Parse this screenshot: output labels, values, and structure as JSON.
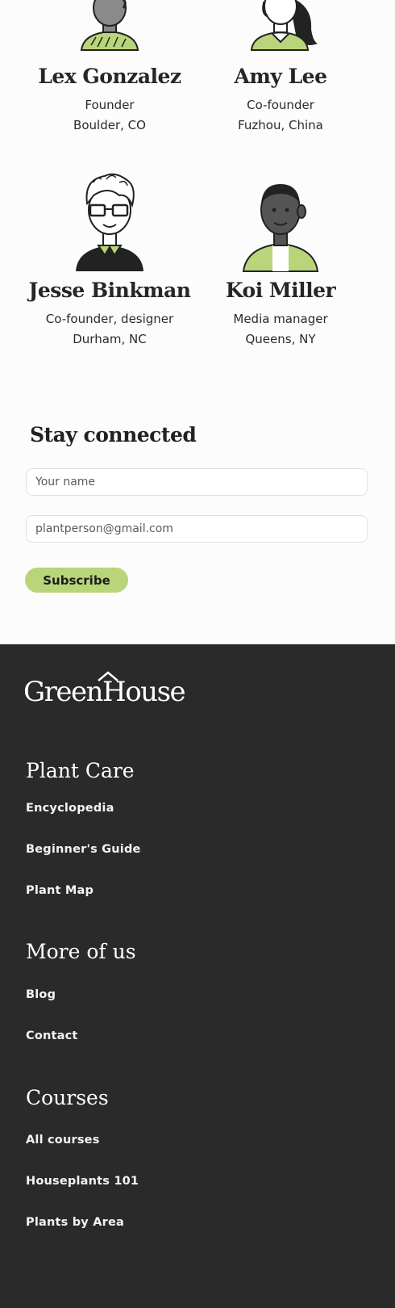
{
  "team": {
    "members": [
      {
        "name": "Lex Gonzalez",
        "role": "Founder",
        "location": "Boulder, CO",
        "avatar": "person-gray-skin-icon"
      },
      {
        "name": "Amy Lee",
        "role": "Co-founder",
        "location": "Fuzhou, China",
        "avatar": "person-long-hair-icon"
      },
      {
        "name": "Jesse Binkman",
        "role": "Co-founder, designer",
        "location": "Durham, NC",
        "avatar": "person-glasses-icon"
      },
      {
        "name": "Koi Miller",
        "role": "Media manager",
        "location": "Queens, NY",
        "avatar": "person-dark-skin-icon"
      }
    ]
  },
  "newsletter": {
    "title": "Stay connected",
    "name_placeholder": "Your name",
    "email_placeholder": "plantperson@gmail.com",
    "subscribe_label": "Subscribe"
  },
  "footer": {
    "logo": "GreenHouse",
    "sections": [
      {
        "title": "Plant Care",
        "links": [
          "Encyclopedia",
          "Beginner's Guide",
          "Plant Map"
        ]
      },
      {
        "title": "More of us",
        "links": [
          "Blog",
          "Contact"
        ]
      },
      {
        "title": "Courses",
        "links": [
          "All courses",
          "Houseplants 101",
          "Plants by Area"
        ]
      }
    ]
  },
  "colors": {
    "accent": "#b9d57a",
    "footer_bg": "#2a2a2a",
    "page_bg": "#fcfcfc"
  }
}
